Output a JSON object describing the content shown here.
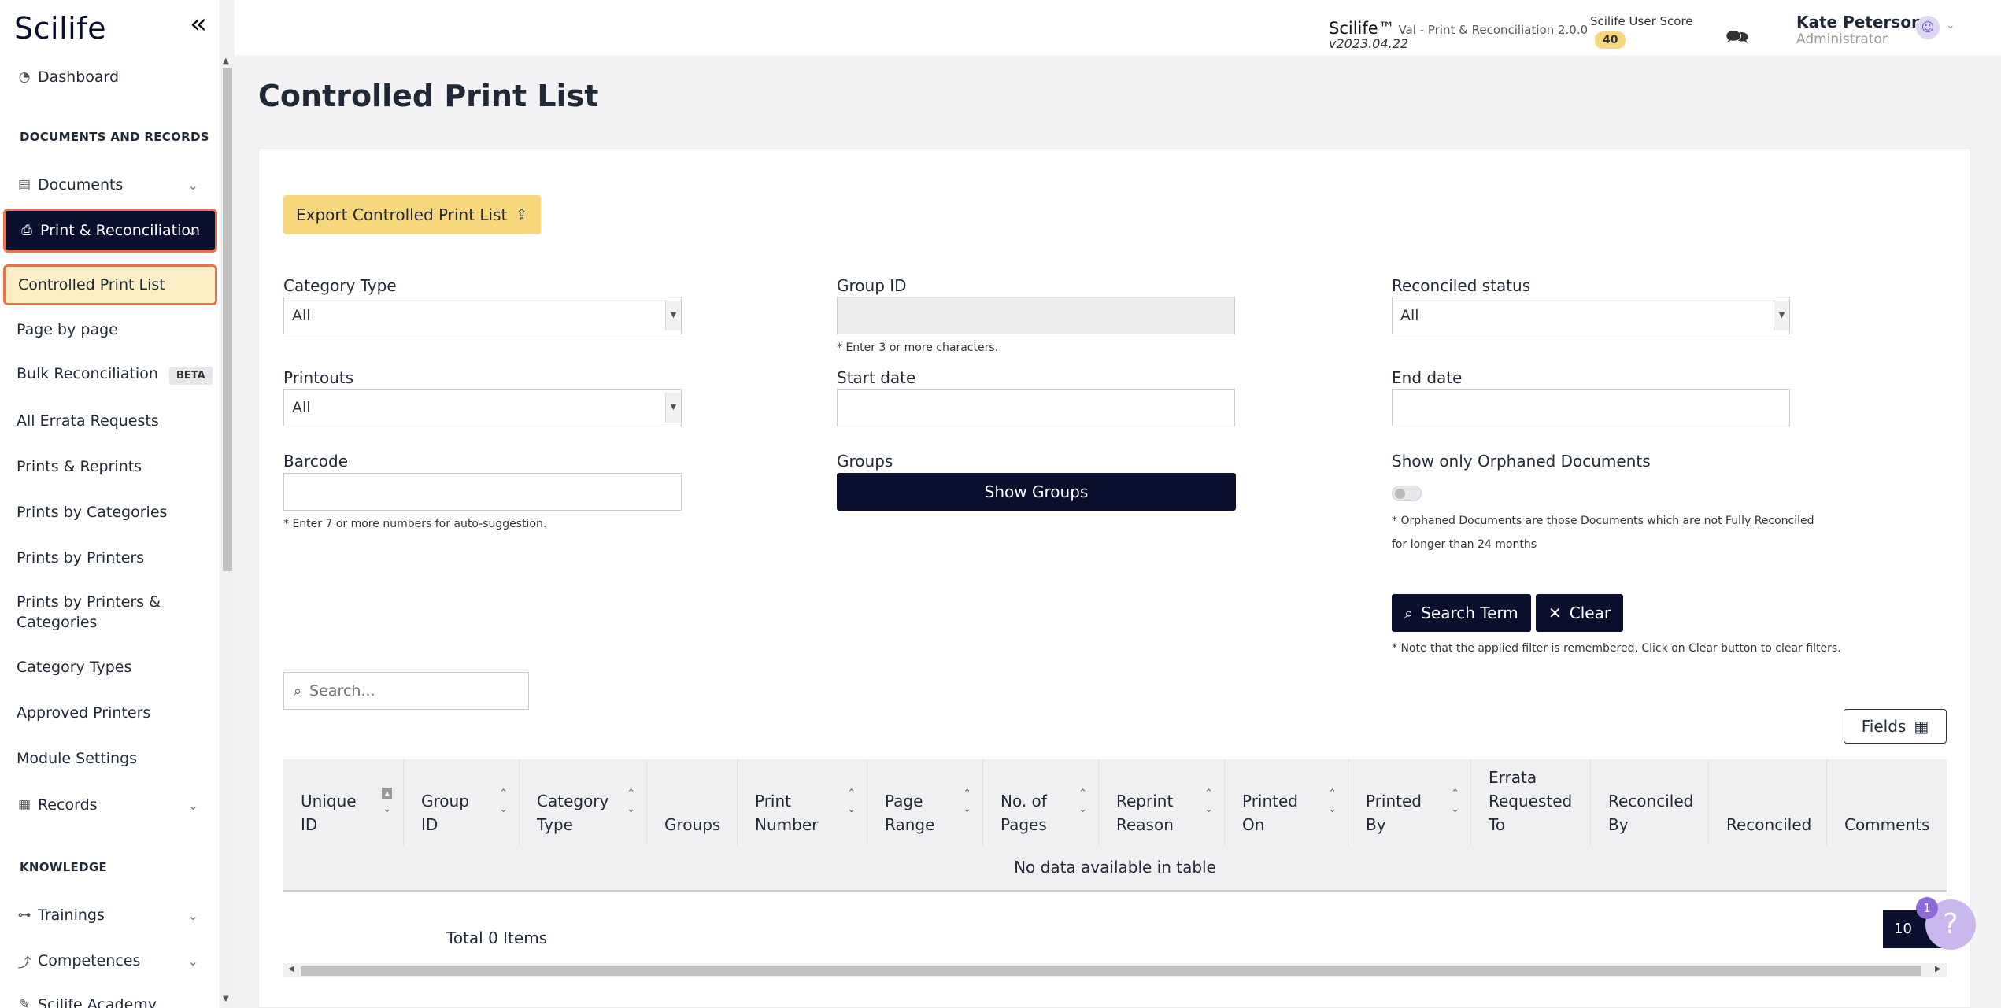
{
  "sidebar": {
    "logo": "Scilife",
    "collapse_icon": "«",
    "items": {
      "dashboard": "Dashboard",
      "section_docs": "DOCUMENTS AND RECORDS",
      "documents": "Documents",
      "print_reconciliation": "Print & Reconciliation",
      "controlled_print_list": "Controlled Print List",
      "page_by_page": "Page by page",
      "bulk_reconciliation": "Bulk Reconciliation",
      "beta": "BETA",
      "all_errata": "All Errata Requests",
      "prints_reprints": "Prints & Reprints",
      "prints_by_categories": "Prints by Categories",
      "prints_by_printers": "Prints by Printers",
      "prints_by_printers_categories_1": "Prints by Printers &",
      "prints_by_printers_categories_2": "Categories",
      "category_types": "Category Types",
      "approved_printers": "Approved Printers",
      "module_settings": "Module Settings",
      "records": "Records",
      "section_knowledge": "KNOWLEDGE",
      "trainings": "Trainings",
      "competences": "Competences",
      "scilife_academy": "Scilife Academy"
    }
  },
  "header": {
    "app_name": "Scilife™",
    "app_sub": " Val - Print & Reconciliation 2.0.0",
    "version": "v2023.04.22",
    "score_label": "Scilife User Score",
    "score_value": "40",
    "user_name": "Kate Peterson",
    "user_role": "Administrator"
  },
  "main": {
    "title": "Controlled Print List",
    "export_label": "Export Controlled Print List",
    "filters": {
      "category_type_label": "Category Type",
      "category_type_value": "All",
      "group_id_label": "Group ID",
      "group_id_hint": "* Enter 3 or more characters.",
      "reconciled_status_label": "Reconciled status",
      "reconciled_status_value": "All",
      "printouts_label": "Printouts",
      "printouts_value": "All",
      "start_date_label": "Start date",
      "end_date_label": "End date",
      "barcode_label": "Barcode",
      "barcode_hint": "* Enter 7 or more numbers for auto-suggestion.",
      "groups_label": "Groups",
      "show_groups_label": "Show Groups",
      "orphaned_label": "Show only Orphaned Documents",
      "orphaned_hint_1": "* Orphaned Documents are those Documents which are not Fully Reconciled",
      "orphaned_hint_2": "for longer than 24 months",
      "search_label": "Search Term",
      "clear_label": "Clear",
      "filter_note": "* Note that the applied filter is remembered. Click on Clear button to clear filters."
    },
    "table": {
      "search_placeholder": "Search...",
      "fields_label": "Fields",
      "columns": [
        {
          "l1": "Unique",
          "l2": "ID"
        },
        {
          "l1": "Group",
          "l2": "ID"
        },
        {
          "l1": "Category",
          "l2": "Type"
        },
        {
          "l1": "",
          "l2": "Groups"
        },
        {
          "l1": "Print",
          "l2": "Number"
        },
        {
          "l1": "Page",
          "l2": "Range"
        },
        {
          "l1": "No. of",
          "l2": "Pages"
        },
        {
          "l1": "Reprint",
          "l2": "Reason"
        },
        {
          "l1": "Printed",
          "l2": "On"
        },
        {
          "l1": "Printed",
          "l2": "By"
        },
        {
          "l0": "Errata",
          "l1": "Requested",
          "l2": "To"
        },
        {
          "l1": "Reconciled",
          "l2": "By"
        },
        {
          "l1": "",
          "l2": "Reconciled"
        },
        {
          "l1": "",
          "l2": "Comments"
        }
      ],
      "empty_text": "No data available in table",
      "total_text": "Total 0 Items",
      "page_size": "10"
    },
    "help_badge": "1",
    "help_icon": "?"
  }
}
